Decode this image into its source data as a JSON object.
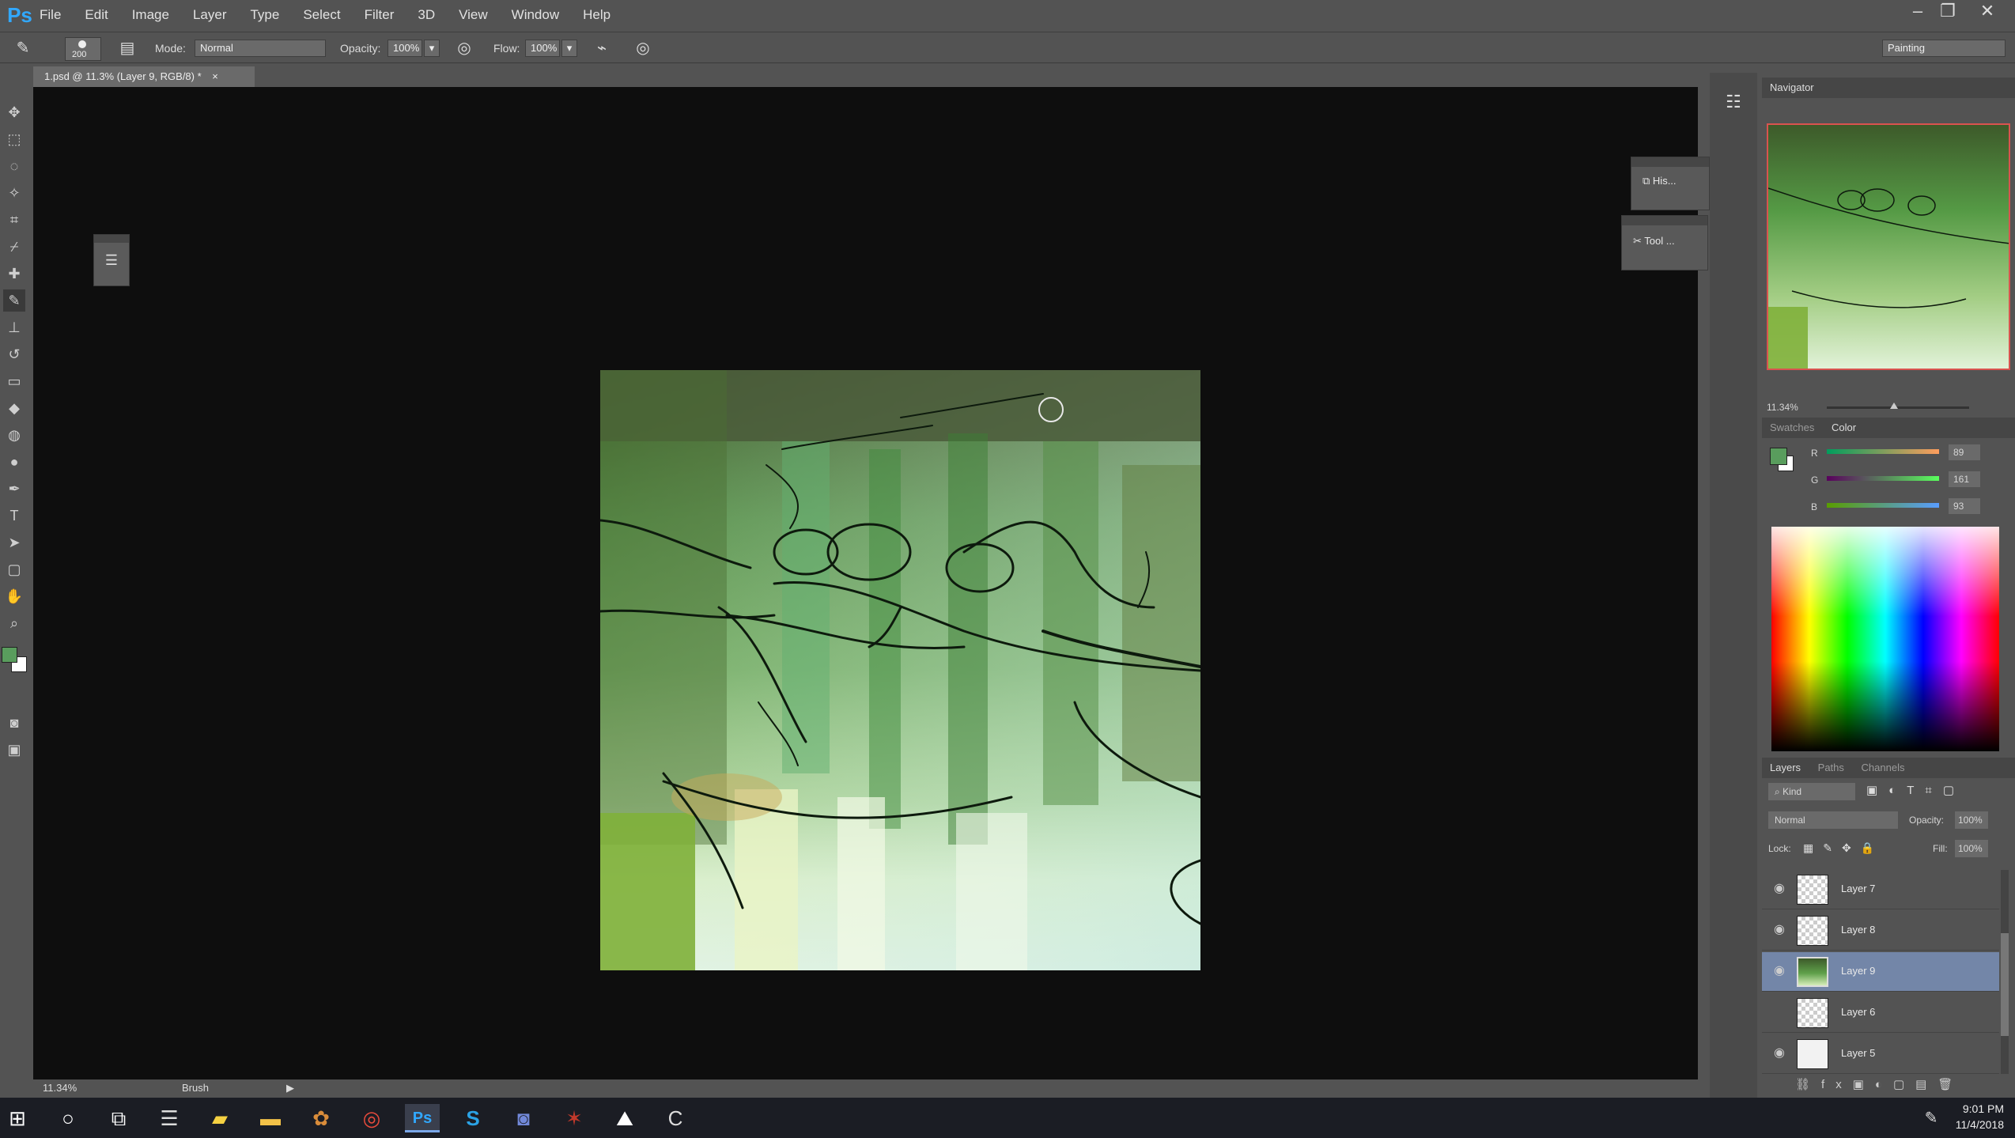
{
  "app": {
    "logo": "Ps",
    "menu": [
      "File",
      "Edit",
      "Image",
      "Layer",
      "Type",
      "Select",
      "Filter",
      "3D",
      "View",
      "Window",
      "Help"
    ]
  },
  "window_controls": {
    "minimize": "–",
    "restore": "❐",
    "close": "✕"
  },
  "options": {
    "brush_size": "200",
    "mode_label": "Mode:",
    "mode_value": "Normal",
    "opacity_label": "Opacity:",
    "opacity_value": "100%",
    "flow_label": "Flow:",
    "flow_value": "100%",
    "workspace": "Painting"
  },
  "document": {
    "tab_title": "1.psd @ 11.3% (Layer 9, RGB/8) *",
    "tab_close": "×"
  },
  "status": {
    "zoom": "11.34%",
    "tool": "Brush"
  },
  "floating_panels": {
    "history_label": "His...",
    "tool_presets_label": "Tool ..."
  },
  "navigator": {
    "title": "Navigator",
    "zoom": "11.34%"
  },
  "color": {
    "tabs": [
      "Swatches",
      "Color"
    ],
    "r_label": "R",
    "r_value": "89",
    "g_label": "G",
    "g_value": "161",
    "b_label": "B",
    "b_value": "93",
    "foreground": "#599d5d",
    "background": "#ffffff"
  },
  "layers": {
    "tabs": [
      "Layers",
      "Paths",
      "Channels"
    ],
    "kind_label": "Kind",
    "blend_mode": "Normal",
    "opacity_label": "Opacity:",
    "opacity_value": "100%",
    "lock_label": "Lock:",
    "fill_label": "Fill:",
    "fill_value": "100%",
    "items": [
      {
        "name": "Layer 7",
        "visible": true,
        "selected": false
      },
      {
        "name": "Layer 8",
        "visible": true,
        "selected": false
      },
      {
        "name": "Layer 9",
        "visible": true,
        "selected": true
      },
      {
        "name": "Layer 6",
        "visible": false,
        "selected": false
      },
      {
        "name": "Layer 5",
        "visible": true,
        "selected": false
      }
    ]
  },
  "taskbar": {
    "time": "9:01 PM",
    "date": "11/4/2018"
  }
}
